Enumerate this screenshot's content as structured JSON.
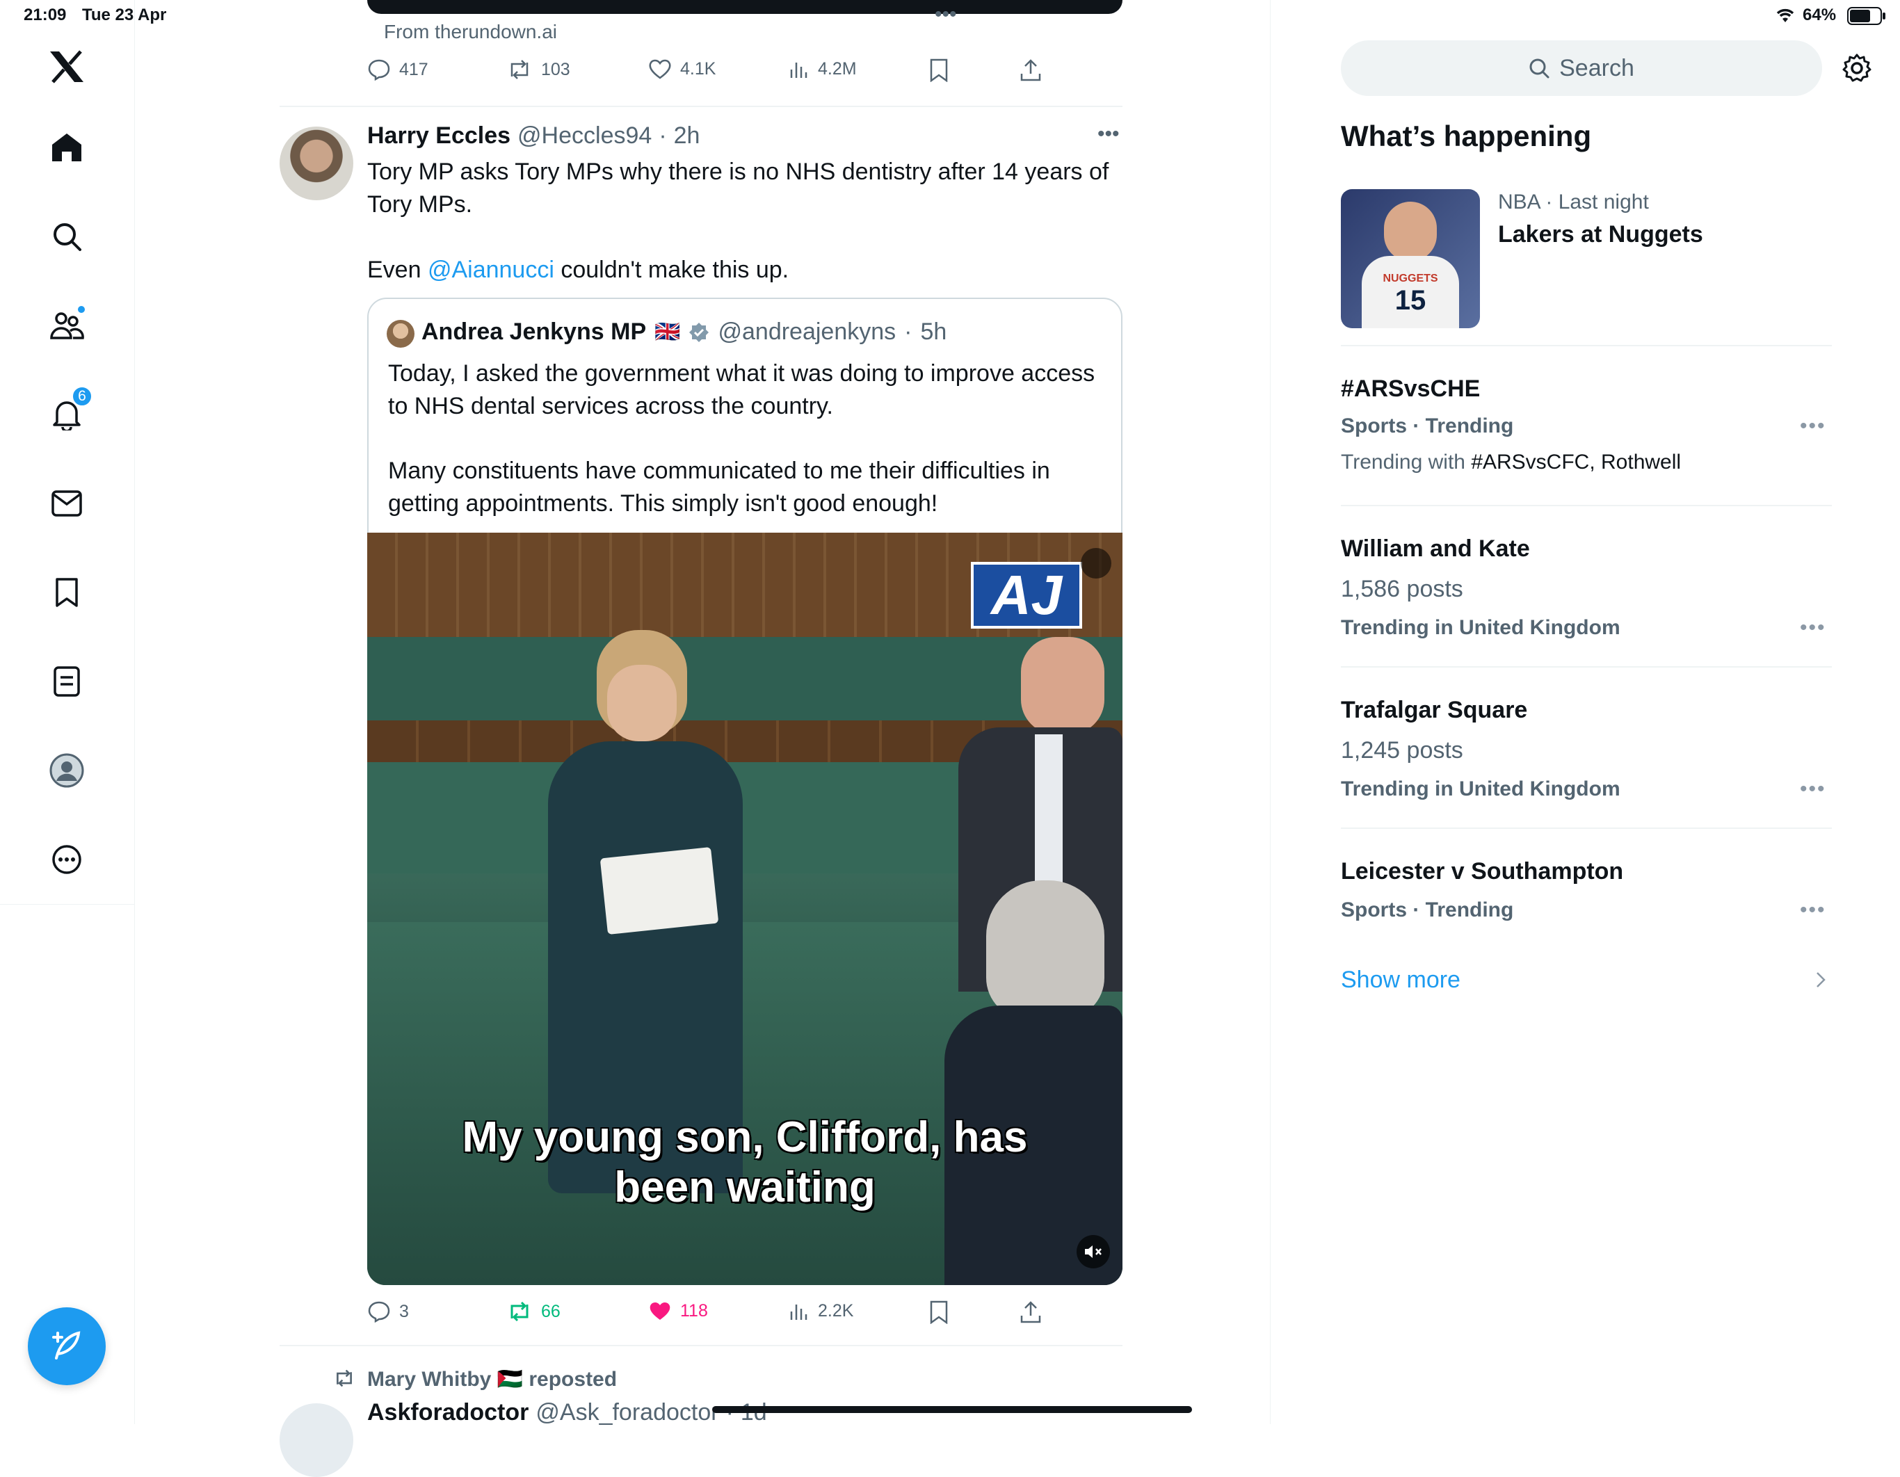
{
  "status_bar": {
    "time": "21:09",
    "date": "Tue 23 Apr",
    "battery": "64%"
  },
  "nav": {
    "notifications_badge": "6"
  },
  "previous_tweet": {
    "source": "From therundown.ai",
    "replies": "417",
    "reposts": "103",
    "likes": "4.1K",
    "views": "4.2M"
  },
  "tweet": {
    "author_name": "Harry Eccles",
    "author_handle": "@Heccles94",
    "time": "2h",
    "text_line1": "Tory MP asks Tory MPs why there is no NHS dentistry after 14 years of",
    "text_line2": "Tory MPs.",
    "text_even": "Even ",
    "mention": "@Aiannucci",
    "text_end": " couldn't make this up.",
    "replies": "3",
    "reposts": "66",
    "likes": "118",
    "views": "2.2K",
    "quote": {
      "author_name": "Andrea Jenkyns MP",
      "flag": "🇬🇧",
      "author_handle": "@andreajenkyns",
      "time": "5h",
      "text_p1_l1": "Today, I asked the government what it was doing to improve access",
      "text_p1_l2": "to NHS dental services across the country.",
      "text_p2_l1": "Many constituents have communicated to me their difficulties in",
      "text_p2_l2": "getting appointments. This simply isn't good enough!",
      "video_logo": "AJ",
      "caption_l1": "My young son, Clifford, has",
      "caption_l2": "been waiting"
    }
  },
  "next_tweet": {
    "repost_by": "Mary Whitby 🇵🇸 reposted",
    "author_name": "Askforadoctor",
    "author_handle": "@Ask_foradoctor",
    "time": "1d"
  },
  "sidebar": {
    "search_placeholder": "Search",
    "title": "What’s happening",
    "featured": {
      "meta": "NBA · Last night",
      "title": "Lakers at Nuggets",
      "jersey_text": "NUGGETS",
      "jersey_number": "15"
    },
    "trends": [
      {
        "title": "#ARSvsCHE",
        "sub": "Sports · Trending",
        "extra_prefix": "Trending with ",
        "extra": "#ARSvsCFC, Rothwell"
      },
      {
        "title": "William and Kate",
        "posts": "1,586 posts",
        "sub": "Trending in United Kingdom"
      },
      {
        "title": "Trafalgar Square",
        "posts": "1,245 posts",
        "sub": "Trending in United Kingdom"
      },
      {
        "title": "Leicester v Southampton",
        "sub": "Sports · Trending"
      }
    ],
    "show_more": "Show more"
  },
  "colors": {
    "accent": "#1d9bf0",
    "like_active": "#f91880",
    "repost_active": "#00ba7c",
    "text_secondary": "#536471"
  },
  "icons": [
    "x-logo-icon",
    "home-icon",
    "search-icon",
    "communities-icon",
    "bell-icon",
    "mail-icon",
    "bookmark-icon",
    "lists-icon",
    "profile-icon",
    "more-icon",
    "compose-icon",
    "reply-icon",
    "repost-icon",
    "like-icon",
    "views-icon",
    "share-icon",
    "verified-icon",
    "gear-icon",
    "mute-icon",
    "chevron-right-icon"
  ]
}
